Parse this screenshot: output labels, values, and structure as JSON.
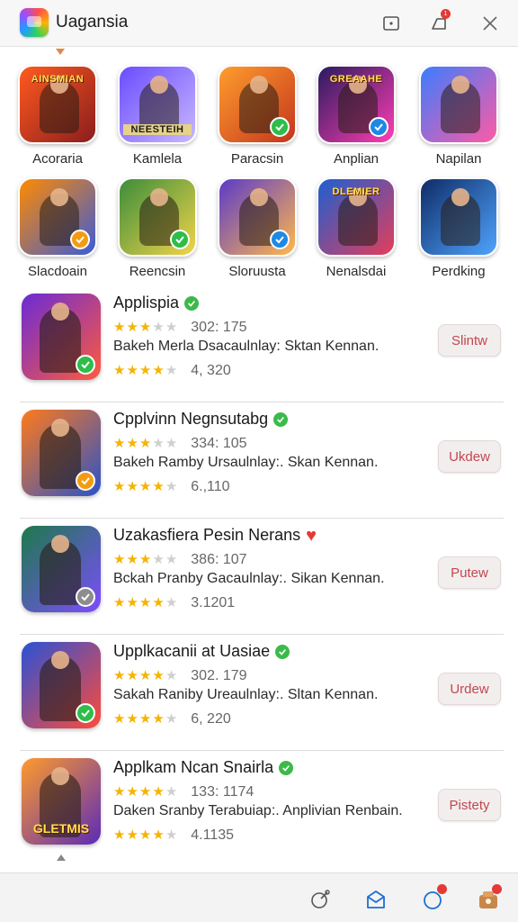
{
  "header": {
    "title": "Uagansia",
    "notification_count": "1"
  },
  "grid": {
    "items": [
      {
        "label": "Acoraria",
        "tile_text": "AINSMIAN",
        "check": "none",
        "colors": [
          "#ff5a1f",
          "#8a1d1d"
        ]
      },
      {
        "label": "Kamlela",
        "tile_text": "NEESTEIH",
        "check": "none",
        "colors": [
          "#6a4cff",
          "#c9b8ff"
        ]
      },
      {
        "label": "Paracsin",
        "tile_text": "",
        "check": "green",
        "colors": [
          "#ff9d2e",
          "#c4351c"
        ]
      },
      {
        "label": "Anplian",
        "tile_text": "GREAAHE",
        "check": "blue",
        "colors": [
          "#2a1b5e",
          "#ff3db3"
        ]
      },
      {
        "label": "Napilan",
        "tile_text": "",
        "check": "none",
        "colors": [
          "#3b7dff",
          "#ff5aa5"
        ]
      },
      {
        "label": "Slacdoain",
        "tile_text": "",
        "check": "orange",
        "colors": [
          "#ff8a00",
          "#3b5bd6"
        ]
      },
      {
        "label": "Reencsin",
        "tile_text": "",
        "check": "green",
        "colors": [
          "#3c8d3a",
          "#f1d44a"
        ]
      },
      {
        "label": "Sloruusta",
        "tile_text": "",
        "check": "blue",
        "colors": [
          "#5b3ac9",
          "#ffb84d"
        ]
      },
      {
        "label": "Nenalsdai",
        "tile_text": "DLEMIER",
        "check": "none",
        "colors": [
          "#1d5fd1",
          "#e43d5a"
        ]
      },
      {
        "label": "Perdking",
        "tile_text": "",
        "check": "none",
        "colors": [
          "#0f2c66",
          "#4fa3ff"
        ]
      }
    ]
  },
  "list": {
    "items": [
      {
        "title": "Applispia",
        "rating_stars": 3,
        "meta": "302: 175",
        "description": "Bakeh Merla Dsacaulnlay: Sktan Kennan.",
        "rating2_stars": 4,
        "downloads": "4, 320",
        "button": "Slintw",
        "badge": "verified",
        "check": "green",
        "tile_text": "",
        "colors": [
          "#6a2bd6",
          "#ff5a3d"
        ]
      },
      {
        "title": "Cpplvinn Negnsutabg",
        "rating_stars": 3,
        "meta": "334: 105",
        "description": "Bakeh Ramby Ursaulnlay:. Skan Kennan.",
        "rating2_stars": 4,
        "downloads": "6.,110",
        "button": "Ukdew",
        "badge": "verified",
        "check": "orange",
        "tile_text": "",
        "colors": [
          "#ff7a1a",
          "#2a52c9"
        ]
      },
      {
        "title": "Uzakasfiera Pesin Nerans",
        "rating_stars": 3,
        "meta": "386: 107",
        "description": "Bckah Pranby Gacaulnlay:. Sikan Kennan.",
        "rating2_stars": 4,
        "downloads": "3.1201",
        "button": "Putew",
        "badge": "heart",
        "check": "gray",
        "tile_text": "",
        "colors": [
          "#1c7a4a",
          "#7d4cff"
        ]
      },
      {
        "title": "Upplkacanii at Uasiae",
        "rating_stars": 4,
        "meta": "302. 179",
        "description": "Sakah Raniby Ureaulnlay:. Sltan Kennan.",
        "rating2_stars": 4,
        "downloads": "6, 220",
        "button": "Urdew",
        "badge": "verified",
        "check": "green",
        "tile_text": "",
        "colors": [
          "#2952d6",
          "#ff4a3a"
        ]
      },
      {
        "title": "Applkam Ncan Snairla",
        "rating_stars": 4,
        "meta": "133: 1174",
        "description": "Daken Sranby Terabuiap:. Anplivian Renbain.",
        "rating2_stars": 4,
        "downloads": "4.1135",
        "button": "Pistety",
        "badge": "verified",
        "check": "none",
        "tile_text": "GLETMIS",
        "colors": [
          "#ff9a2a",
          "#5b2bb8"
        ]
      }
    ]
  },
  "colors": {
    "accent_red": "#c2474f",
    "star": "#f4b400",
    "verified_green": "#3cb94a"
  }
}
